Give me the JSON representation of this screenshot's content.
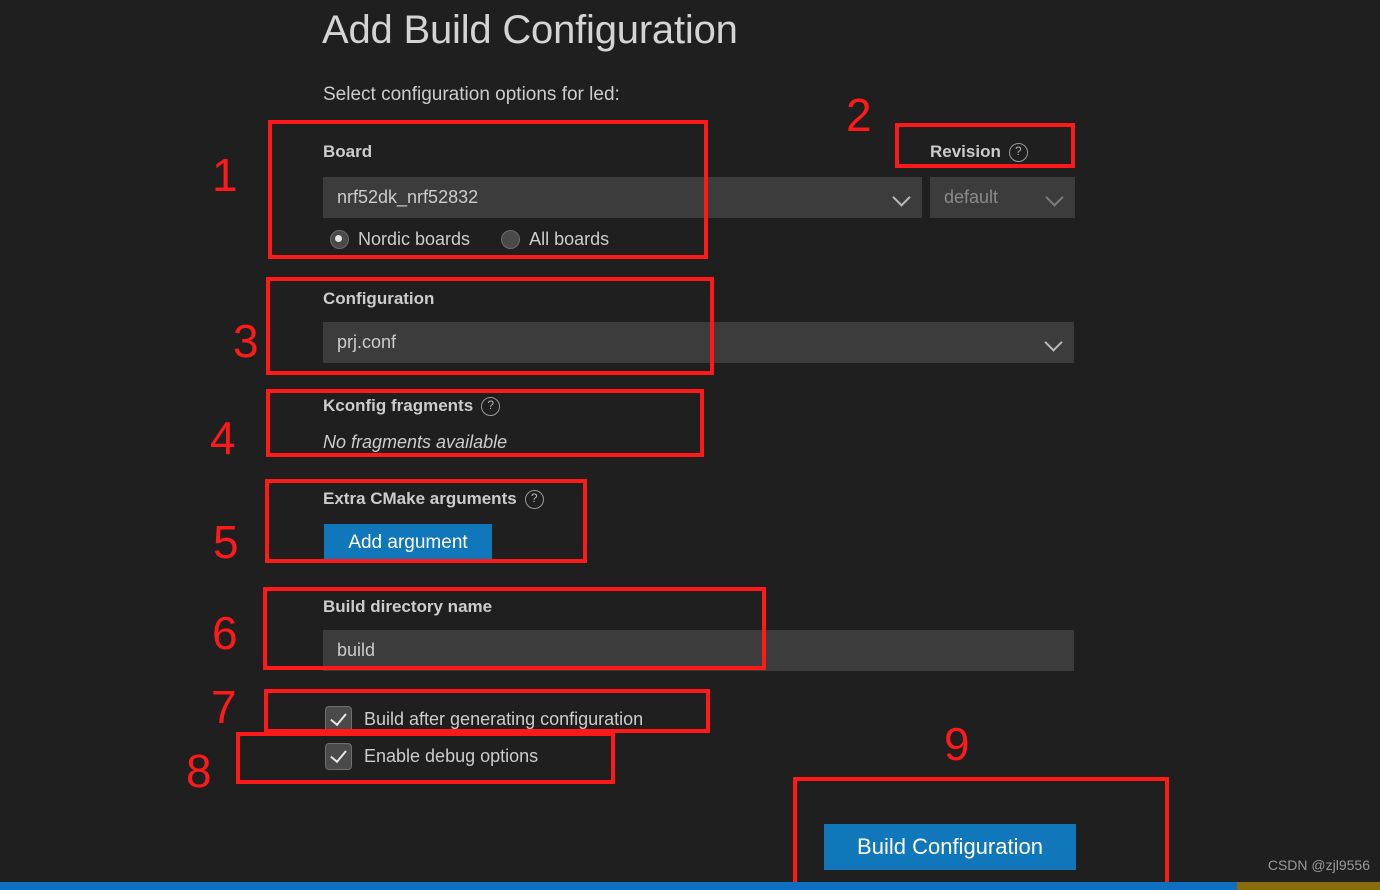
{
  "page": {
    "title": "Add Build Configuration",
    "subtitle": "Select configuration options for led:"
  },
  "colors": {
    "background": "#1f1f1f",
    "input_background": "#3c3c3c",
    "accent_blue": "#1177bb",
    "annotation_red": "#ff1a1a",
    "statusbar_blue": "#0e70c0",
    "statusbar_segment": "#8a6d0b",
    "text": "#cccccc"
  },
  "board": {
    "label": "Board",
    "value": "nrf52dk_nrf52832",
    "chevron_icon": "chevron-down-icon",
    "radios": [
      {
        "label": "Nordic boards",
        "selected": true
      },
      {
        "label": "All boards",
        "selected": false
      }
    ]
  },
  "revision": {
    "label": "Revision",
    "help_icon": "question-circle-icon",
    "value": "default",
    "chevron_icon": "chevron-down-icon"
  },
  "configuration": {
    "label": "Configuration",
    "value": "prj.conf",
    "chevron_icon": "chevron-down-icon"
  },
  "kconfig": {
    "label": "Kconfig fragments",
    "help_icon": "question-circle-icon",
    "note": "No fragments available"
  },
  "cmake": {
    "label": "Extra CMake arguments",
    "help_icon": "question-circle-icon",
    "add_button": "Add argument"
  },
  "build_directory": {
    "label": "Build directory name",
    "value": "build"
  },
  "checkboxes": [
    {
      "label": "Build after generating configuration",
      "checked": true
    },
    {
      "label": "Enable debug options",
      "checked": true
    }
  ],
  "submit": {
    "label": "Build Configuration"
  },
  "annotations": [
    {
      "number": "1"
    },
    {
      "number": "2"
    },
    {
      "number": "3"
    },
    {
      "number": "4"
    },
    {
      "number": "5"
    },
    {
      "number": "6"
    },
    {
      "number": "7"
    },
    {
      "number": "8"
    },
    {
      "number": "9"
    }
  ],
  "watermark": "CSDN @zjl9556"
}
